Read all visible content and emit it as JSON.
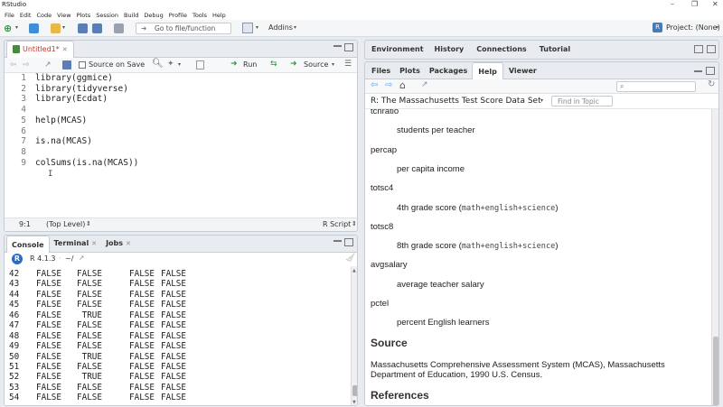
{
  "window": {
    "title": "RStudio"
  },
  "menu": [
    "File",
    "Edit",
    "Code",
    "View",
    "Plots",
    "Session",
    "Build",
    "Debug",
    "Profile",
    "Tools",
    "Help"
  ],
  "toolbar": {
    "goto_placeholder": "Go to file/function",
    "addins": "Addins",
    "project": "Project: (None)"
  },
  "editor": {
    "tab": "Untitled1*",
    "source_on_save": "Source on Save",
    "run": "Run",
    "source": "Source",
    "line_numbers": [
      "1",
      "2",
      "3",
      "4",
      "5",
      "6",
      "7",
      "8",
      "9"
    ],
    "lines": [
      "library(ggmice)",
      "library(tidyverse)",
      "library(Ecdat)",
      "",
      "help(MCAS)",
      "",
      "is.na(MCAS)",
      "",
      "colSums(is.na(MCAS))"
    ],
    "status_pos": "9:1",
    "status_scope": "(Top Level)",
    "status_type": "R Script"
  },
  "console": {
    "tabs": [
      "Console",
      "Terminal",
      "Jobs"
    ],
    "version": "R 4.1.3",
    "path": "~/",
    "rows": [
      [
        "42",
        "FALSE",
        "FALSE",
        "FALSE",
        "FALSE"
      ],
      [
        "43",
        "FALSE",
        "FALSE",
        "FALSE",
        "FALSE"
      ],
      [
        "44",
        "FALSE",
        "FALSE",
        "FALSE",
        "FALSE"
      ],
      [
        "45",
        "FALSE",
        "FALSE",
        "FALSE",
        "FALSE"
      ],
      [
        "46",
        "FALSE",
        "TRUE",
        "FALSE",
        "FALSE"
      ],
      [
        "47",
        "FALSE",
        "FALSE",
        "FALSE",
        "FALSE"
      ],
      [
        "48",
        "FALSE",
        "FALSE",
        "FALSE",
        "FALSE"
      ],
      [
        "49",
        "FALSE",
        "FALSE",
        "FALSE",
        "FALSE"
      ],
      [
        "50",
        "FALSE",
        "TRUE",
        "FALSE",
        "FALSE"
      ],
      [
        "51",
        "FALSE",
        "FALSE",
        "FALSE",
        "FALSE"
      ],
      [
        "52",
        "FALSE",
        "TRUE",
        "FALSE",
        "FALSE"
      ],
      [
        "53",
        "FALSE",
        "FALSE",
        "FALSE",
        "FALSE"
      ],
      [
        "54",
        "FALSE",
        "FALSE",
        "FALSE",
        "FALSE"
      ]
    ]
  },
  "env_tabs": [
    "Environment",
    "History",
    "Connections",
    "Tutorial"
  ],
  "help_tabs": [
    "Files",
    "Plots",
    "Packages",
    "Help",
    "Viewer"
  ],
  "help": {
    "topic_title": "R: The Massachusetts Test Score Data Set",
    "find_placeholder": "Find in Topic",
    "items": [
      {
        "term": "tchratio",
        "desc": "students per teacher"
      },
      {
        "term": "percap",
        "desc": "per capita income"
      },
      {
        "term": "totsc4",
        "desc": "4th grade score (",
        "code": "math+english+science",
        "tail": ")"
      },
      {
        "term": "totsc8",
        "desc": "8th grade score (",
        "code": "math+english+science",
        "tail": ")"
      },
      {
        "term": "avgsalary",
        "desc": "average teacher salary"
      },
      {
        "term": "pctel",
        "desc": "percent English learners"
      }
    ],
    "source_heading": "Source",
    "source_text_1": "Massachusetts Comprehensive Assessment System (MCAS), Massachusetts",
    "source_text_2": "Department of Education, 1990 U.S. Census.",
    "references_heading": "References"
  },
  "colors": {
    "accent": "#2b6cc4",
    "line_number": "#7a7a7a",
    "chrome": "#e8ecf0"
  }
}
